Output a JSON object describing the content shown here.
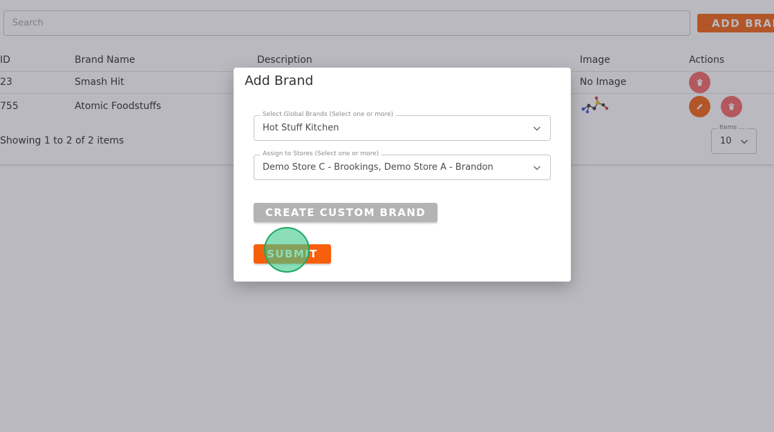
{
  "search": {
    "placeholder": "Search"
  },
  "toolbar": {
    "add_brand_label": "ADD BRAND"
  },
  "table": {
    "headers": {
      "id": "ID",
      "name": "Brand Name",
      "description": "Description",
      "image": "Image",
      "actions": "Actions"
    },
    "rows": [
      {
        "id": "23",
        "name": "Smash Hit",
        "image_text": "No Image"
      },
      {
        "id": "755",
        "name": "Atomic Foodstuffs",
        "image_text": ""
      }
    ]
  },
  "pagination": {
    "summary": "Showing 1 to 2 of 2 items",
    "items_label": "Items ...",
    "items_value": "10"
  },
  "modal": {
    "title": "Add Brand",
    "global_brands": {
      "label": "Select Global Brands (Select one or more)",
      "value": "Hot Stuff Kitchen"
    },
    "stores": {
      "label": "Assign to Stores (Select one or more)",
      "value": "Demo Store C - Brookings, Demo Store A - Brandon"
    },
    "create_custom_label": "CREATE CUSTOM BRAND",
    "submit_label": "SUBMIT"
  },
  "colors": {
    "accent": "#f36a1c",
    "delete": "#f36d6d",
    "disabled": "#b3b3b5",
    "click_marker": "#40c88c"
  },
  "icons": [
    "trash-icon",
    "pencil-icon",
    "chevron-down-icon",
    "brand-logo-molecule"
  ]
}
